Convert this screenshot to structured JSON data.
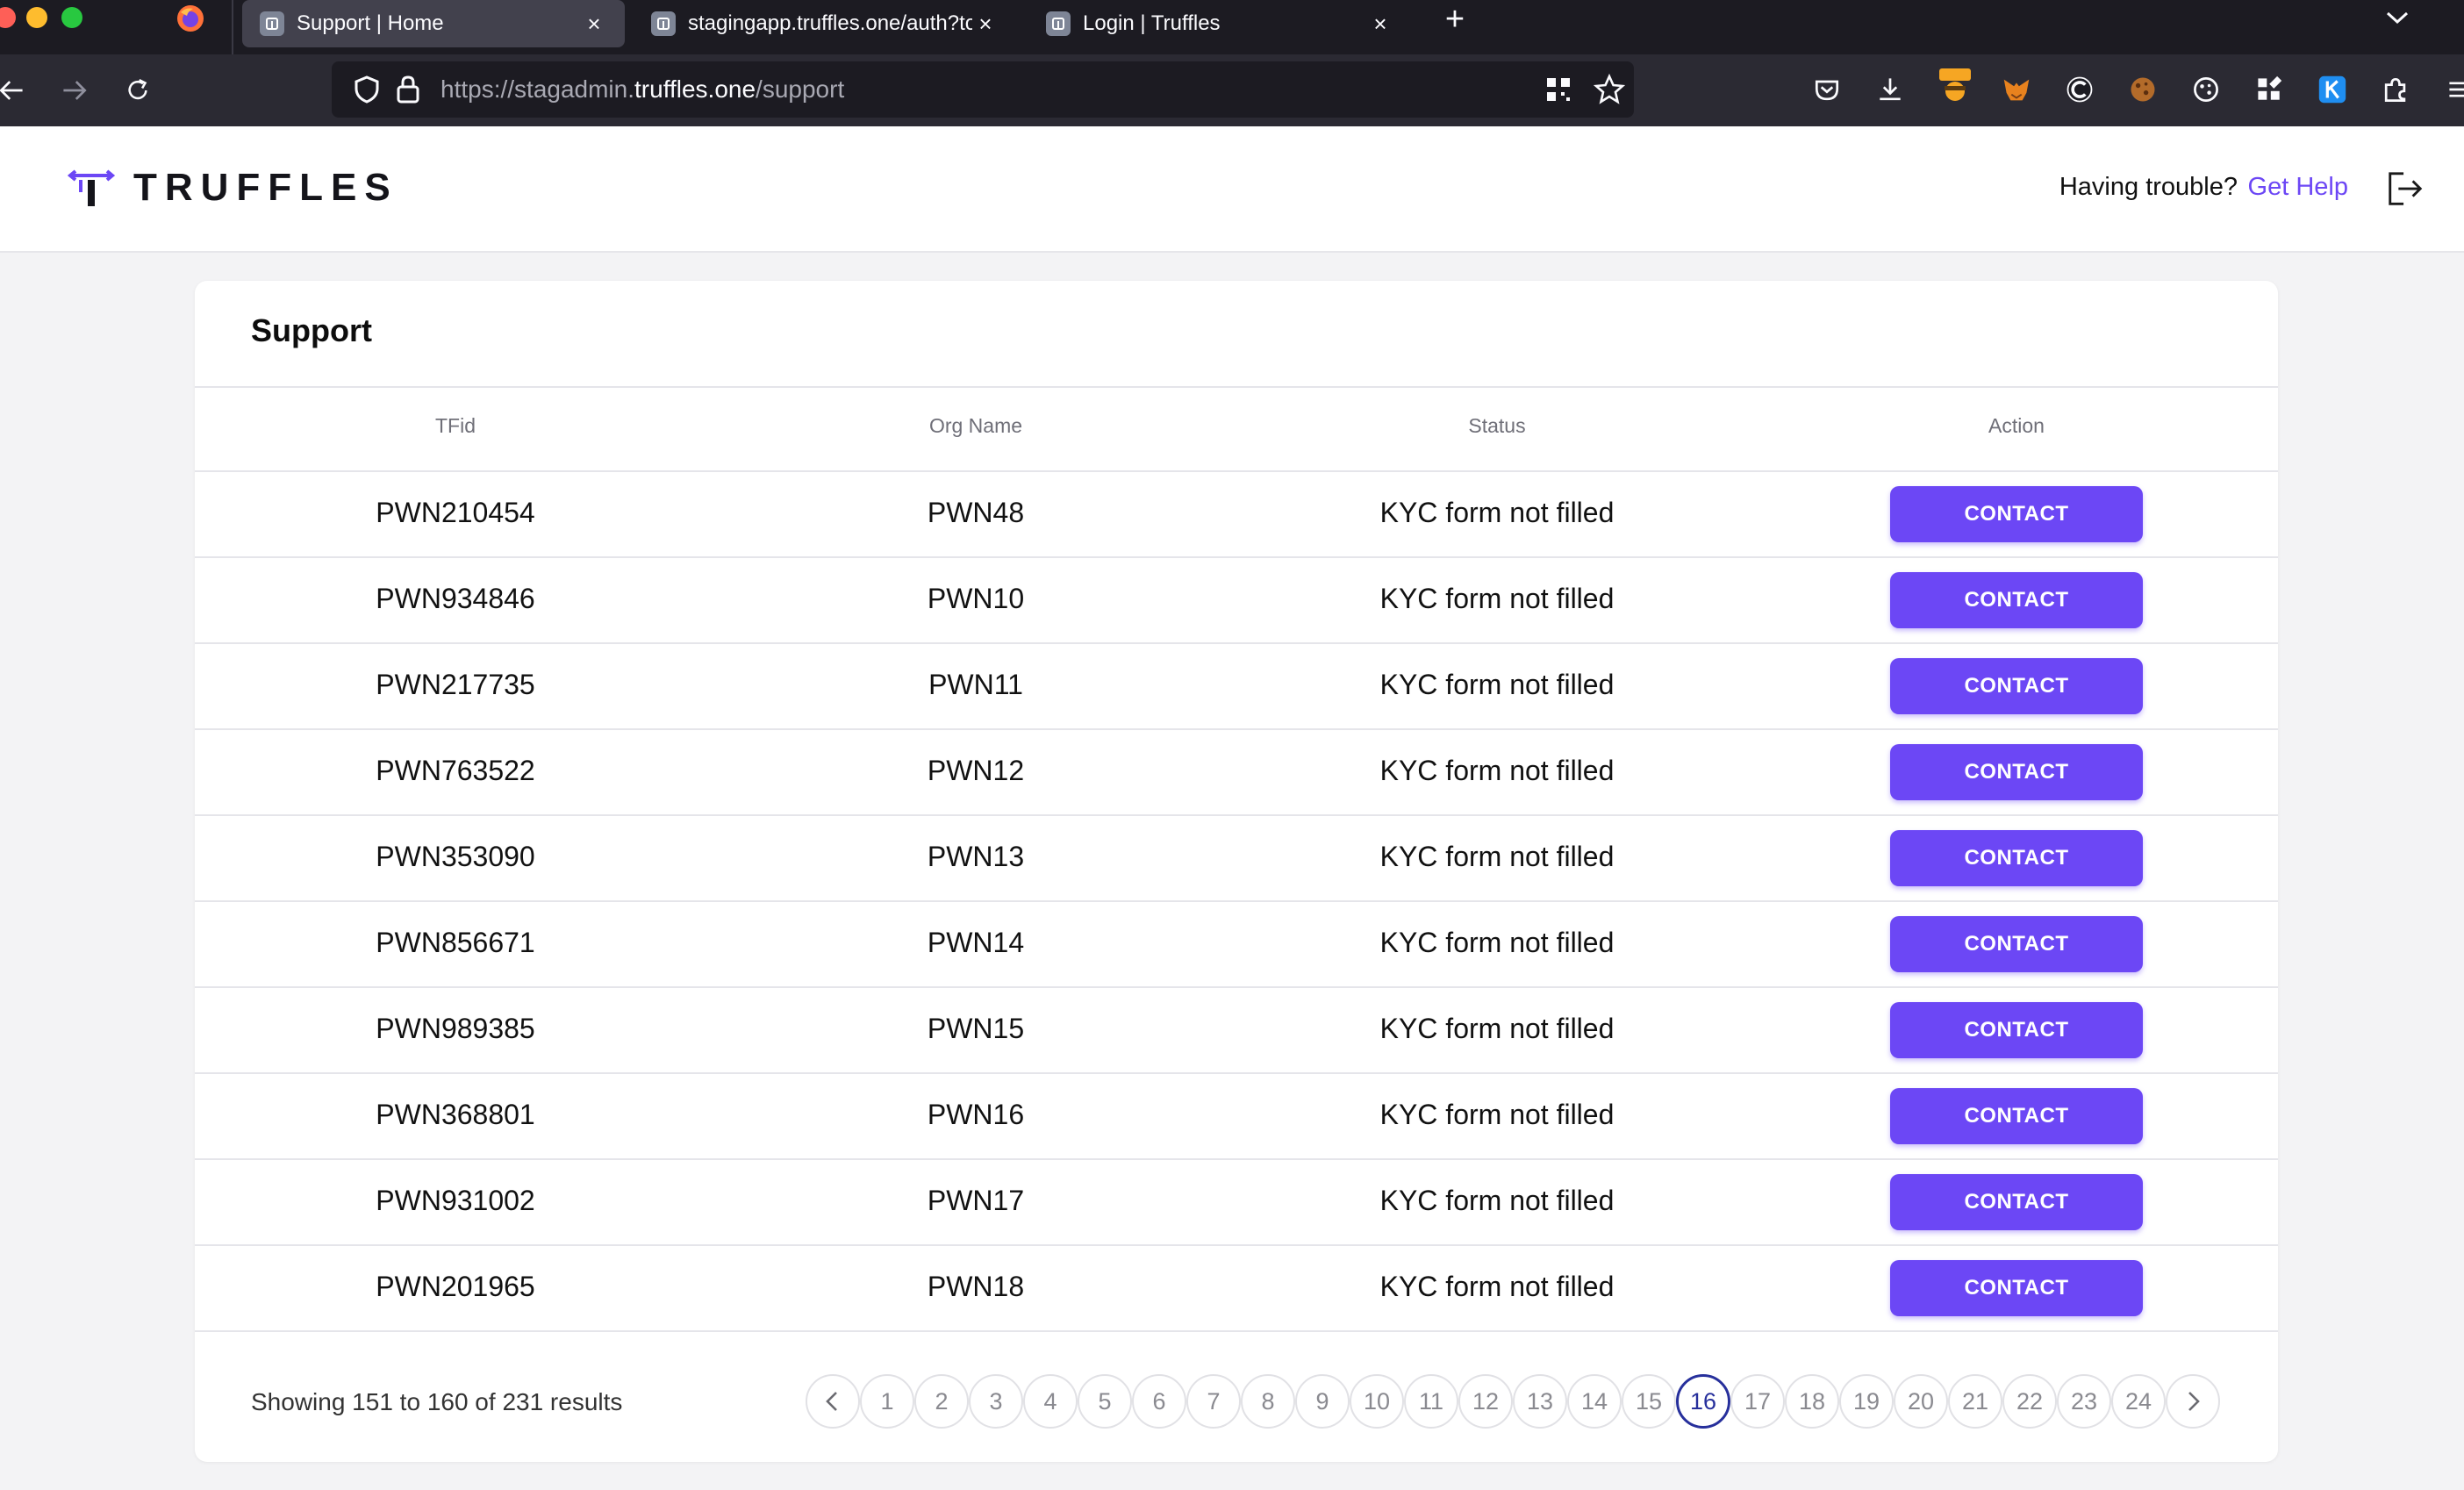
{
  "browser": {
    "tabs": [
      {
        "title": "Support | Home",
        "active": true
      },
      {
        "title": "stagingapp.truffles.one/auth?to",
        "active": false
      },
      {
        "title": "Login | Truffles",
        "active": false
      }
    ],
    "url": {
      "prefix": "https://stagadmin.",
      "domain": "truffles.one",
      "path": "/support"
    },
    "extension_icons": [
      "pocket-icon",
      "download-icon",
      "burp-extension-icon",
      "metamask-icon",
      "extension-c-icon",
      "cookie-icon",
      "cookie-editor-icon",
      "extensions-grid-icon",
      "k-extension-icon",
      "extensions-puzzle-icon",
      "menu-icon"
    ]
  },
  "header": {
    "brand": "TRUFFLES",
    "help_text": "Having trouble?",
    "help_link": "Get Help",
    "brand_color": "#6c47f5"
  },
  "support": {
    "title": "Support",
    "columns": [
      "TFid",
      "Org Name",
      "Status",
      "Action"
    ],
    "rows": [
      {
        "tfid": "PWN210454",
        "org": "PWN48",
        "status": "KYC form not filled",
        "action": "CONTACT"
      },
      {
        "tfid": "PWN934846",
        "org": "PWN10",
        "status": "KYC form not filled",
        "action": "CONTACT"
      },
      {
        "tfid": "PWN217735",
        "org": "PWN11",
        "status": "KYC form not filled",
        "action": "CONTACT"
      },
      {
        "tfid": "PWN763522",
        "org": "PWN12",
        "status": "KYC form not filled",
        "action": "CONTACT"
      },
      {
        "tfid": "PWN353090",
        "org": "PWN13",
        "status": "KYC form not filled",
        "action": "CONTACT"
      },
      {
        "tfid": "PWN856671",
        "org": "PWN14",
        "status": "KYC form not filled",
        "action": "CONTACT"
      },
      {
        "tfid": "PWN989385",
        "org": "PWN15",
        "status": "KYC form not filled",
        "action": "CONTACT"
      },
      {
        "tfid": "PWN368801",
        "org": "PWN16",
        "status": "KYC form not filled",
        "action": "CONTACT"
      },
      {
        "tfid": "PWN931002",
        "org": "PWN17",
        "status": "KYC form not filled",
        "action": "CONTACT"
      },
      {
        "tfid": "PWN201965",
        "org": "PWN18",
        "status": "KYC form not filled",
        "action": "CONTACT"
      }
    ],
    "results_text": "Showing 151 to 160 of 231 results",
    "pagination": {
      "pages": [
        "1",
        "2",
        "3",
        "4",
        "5",
        "6",
        "7",
        "8",
        "9",
        "10",
        "11",
        "12",
        "13",
        "14",
        "15",
        "16",
        "17",
        "18",
        "19",
        "20",
        "21",
        "22",
        "23",
        "24"
      ],
      "current": "16"
    }
  }
}
